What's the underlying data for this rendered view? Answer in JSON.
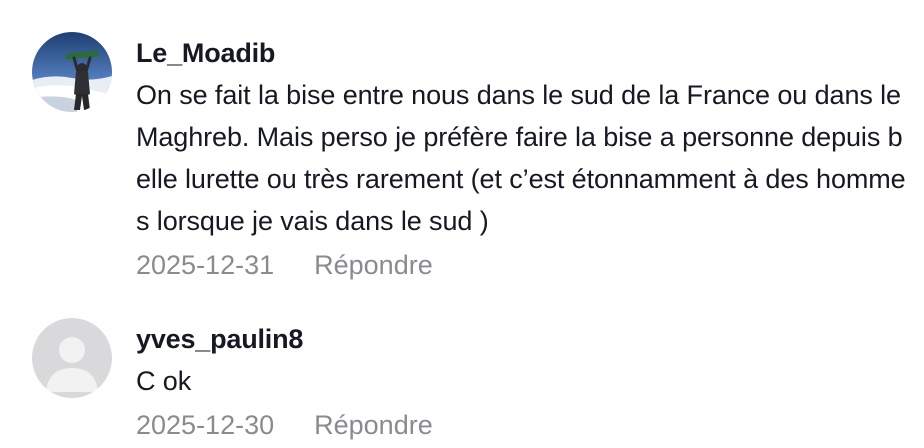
{
  "comments": [
    {
      "username": "Le_Moadib",
      "avatar_icon": "user-photo-avatar",
      "text": "On se fait la bise entre nous dans le sud de la France ou dans le Maghreb. Mais perso je préfère faire la bise a personne depuis belle lurette ou très rarement (et c’est étonnamment à des hommes lorsque je vais dans le sud )",
      "date": "2025-12-31",
      "reply_label": "Répondre"
    },
    {
      "username": "yves_paulin8",
      "avatar_icon": "default-user-avatar",
      "text": "C ok",
      "date": "2025-12-30",
      "reply_label": "Répondre"
    }
  ],
  "colors": {
    "text": "#161823",
    "meta": "#8a8b91",
    "default_avatar_bg": "#d9d9dc",
    "default_avatar_fg": "#f2f2f3"
  }
}
